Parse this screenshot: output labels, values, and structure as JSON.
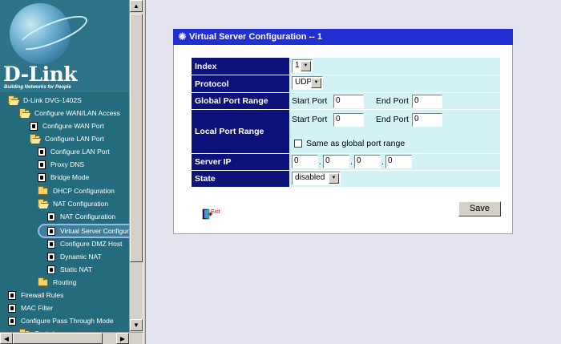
{
  "sidebar": {
    "brand": "D-Link",
    "slogan": "Building Networks for People",
    "items": [
      {
        "label": "D-Link DVG-1402S",
        "icon": "open-folder-icon"
      },
      {
        "label": "Configure WAN/LAN Access",
        "icon": "open-folder-icon"
      },
      {
        "label": "Configure WAN Port",
        "icon": "document-icon"
      },
      {
        "label": "Configure LAN Port",
        "icon": "open-folder-icon"
      },
      {
        "label": "Configure LAN Port",
        "icon": "document-icon"
      },
      {
        "label": "Proxy DNS",
        "icon": "document-icon"
      },
      {
        "label": "Bridge Mode",
        "icon": "document-icon"
      },
      {
        "label": "DHCP Configuration",
        "icon": "folder-icon"
      },
      {
        "label": "NAT Configuration",
        "icon": "open-folder-icon"
      },
      {
        "label": "NAT Configuration",
        "icon": "document-icon"
      },
      {
        "label": "Virtual Server Configurat",
        "icon": "document-icon"
      },
      {
        "label": "Configure DMZ Host",
        "icon": "document-icon"
      },
      {
        "label": "Dynamic NAT",
        "icon": "document-icon"
      },
      {
        "label": "Static NAT",
        "icon": "document-icon"
      },
      {
        "label": "Routing",
        "icon": "folder-icon"
      },
      {
        "label": "Firewall Rules",
        "icon": "document-icon"
      },
      {
        "label": "MAC Filter",
        "icon": "document-icon"
      },
      {
        "label": "Configure Pass Through Mode",
        "icon": "document-icon"
      },
      {
        "label": "Statistics",
        "icon": "folder-icon"
      }
    ],
    "selected_index": 10
  },
  "panel": {
    "title": "Virtual Server Configuration -- 1",
    "labels": {
      "index": "Index",
      "protocol": "Protocol",
      "global_port_range": "Global Port Range",
      "local_port_range": "Local Port Range",
      "server_ip": "Server IP",
      "state": "State"
    },
    "index_value": "1",
    "protocol_value": "UDP",
    "global": {
      "start_label": "Start Port",
      "start_value": "0",
      "end_label": "End Port",
      "end_value": "0"
    },
    "local": {
      "start_label": "Start Port",
      "start_value": "0",
      "end_label": "End Port",
      "end_value": "0"
    },
    "same_as_global_label": "Same as global port range",
    "same_as_global_checked": false,
    "server_ip": [
      "0",
      "0",
      "0",
      "0"
    ],
    "ip_separator": ".",
    "state_value": "disabled",
    "exit_label": "Exit",
    "save_label": "Save"
  },
  "colors": {
    "sidebar_bg": "#246b7d",
    "title_bar": "#2230d3",
    "label_bg": "#0d127a",
    "value_bg": "#d3f2f6",
    "content_bg": "#e3e4ef"
  }
}
